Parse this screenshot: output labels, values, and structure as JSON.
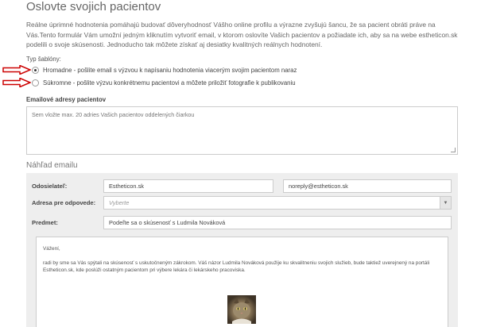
{
  "page": {
    "title": "Oslovte svojich pacientov",
    "intro": "Reálne úprimné hodnotenia pomáhajú budovať dôveryhodnosť Vášho online profilu a výrazne zvyšujú šancu, že sa pacient obráti práve na Vás.Tento formulár Vám umožní jedným kliknutím vytvoriť email, v ktorom oslovíte Vašich pacientov a požiadate ich, aby sa na webe estheticon.sk podelili o svoje skúsenosti. Jednoducho tak môžete získať aj desiatky kvalitných reálnych hodnotení."
  },
  "templates": {
    "label": "Typ šablóny:",
    "options": [
      {
        "label": "Hromadne - pošlite email s výzvou k napísaniu hodnotenia viacerým svojim pacientom naraz",
        "selected": true
      },
      {
        "label": "Súkromne - pošlite výzvu konkrétnemu pacientovi a môžete priložiť fotografie k publikovaniu",
        "selected": false
      }
    ]
  },
  "emails": {
    "label": "Emailové adresy pacientov",
    "placeholder": "Sem vložte max. 20 adries Vašich pacientov oddelených čiarkou"
  },
  "preview": {
    "title": "Náhľad emailu",
    "sender_label": "Odosielateľ:",
    "sender_name": "Estheticon.sk",
    "sender_email": "noreply@estheticon.sk",
    "reply_label": "Adresa pre odpovede:",
    "reply_value": "Vyberte",
    "subject_label": "Predmet:",
    "subject_value": "Podeľte sa o skúsenosť s Ludmila Nováková",
    "body_greeting": "Vážení,",
    "body_text": "radi by sme sa Vás spýtali na skúsenosť s uskutočneným zákrokom. Váš názor Ludmila Nováková použije ku skvalitneniu svojich služieb, bude taktiež uverejnený na portáli Estheticon.sk, kde poslúži ostatným pacientom pri výbere lekára či lekárskeho pracoviska."
  },
  "colors": {
    "arrow": "#cc0000",
    "panel": "#eeeeee"
  }
}
